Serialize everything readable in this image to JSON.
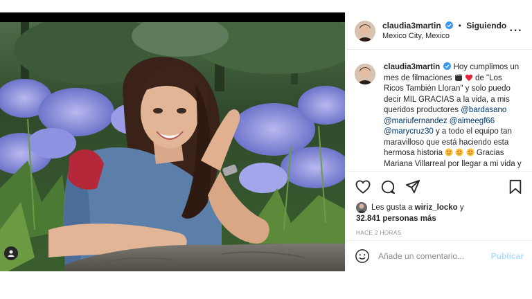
{
  "post": {
    "username": "claudia3martin",
    "follow_status": "Siguiendo",
    "location": "Mexico City, Mexico",
    "more_icon": "more-options-icon"
  },
  "caption": {
    "username": "claudia3martin",
    "text_1": "Hoy cumplimos un mes de filmaciones",
    "text_2": "de \"Los Ricos También Lloran\" y solo puedo decir MIL GRACIAS a la vida, a mis queridos productores",
    "mention_1": "@bardasano",
    "mention_2": "@mariufernandez",
    "mention_3": "@aimeegf66",
    "mention_4": "@marycruz30",
    "text_3": "y a todo el equipo tan maravilloso que está haciendo esta hermosa historia",
    "text_4": "Gracias Mariana Villarreal por llegar a mi vida y"
  },
  "likes": {
    "prefix": "Les gusta a",
    "liker": "wiriz_locko",
    "conjunction": "y",
    "count_text": "32.841 personas más"
  },
  "timestamp": "HACE 2 HORAS",
  "comment": {
    "placeholder": "Añade un comentario...",
    "publish_label": "Publicar"
  },
  "colors": {
    "verified": "#3897f0",
    "heart": "#ed4956",
    "mention": "#00376b",
    "publish_disabled": "#b2dffc"
  }
}
